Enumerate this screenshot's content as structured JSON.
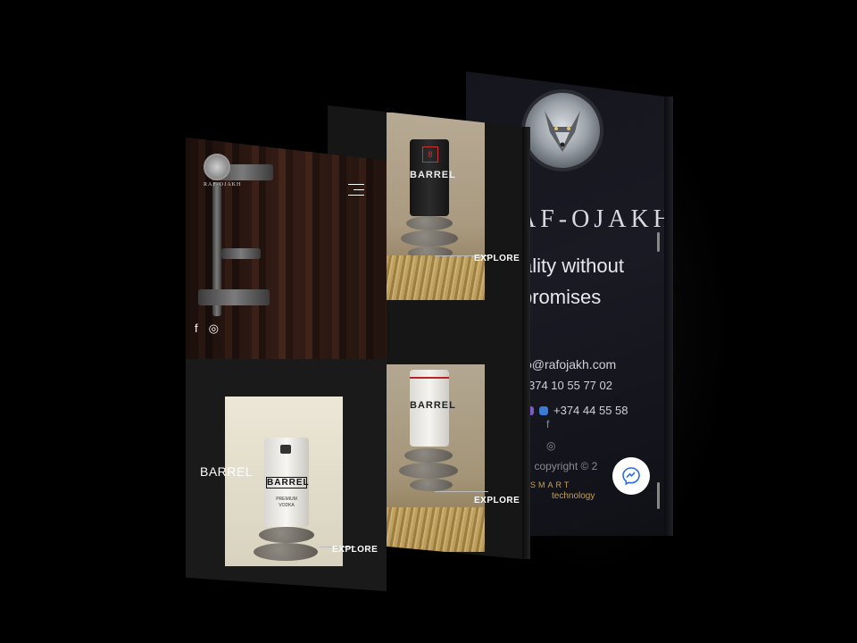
{
  "back_screen": {
    "brand": "AF-OJAKH",
    "tagline_line1": "ality without",
    "tagline_line2": "promises",
    "email": "o@rafojakh.com",
    "phone1": "374 10 55 77 02",
    "phone2": "+374 44 55 58",
    "copyright": "h | copyright © 2",
    "partner_line1": "SMART",
    "partner_line2": "technology",
    "social": [
      "f",
      "◎"
    ]
  },
  "middle_screen": {
    "products": [
      {
        "can_label": "BARREL",
        "cta": "EXPLORE"
      },
      {
        "can_label": "BARREL",
        "cta": "EXPLORE"
      }
    ]
  },
  "front_screen": {
    "logo_text": "RAF-OJAKH",
    "social": [
      "f",
      "◎"
    ],
    "product_title": "BARREL",
    "can_label": "BARREL",
    "can_sub1": "PREMIUM",
    "can_sub2": "VODKA",
    "cta": "EXPLORE"
  },
  "colors": {
    "background": "#000000",
    "accent_gold": "#c8a24a",
    "dark_screen": "#161616"
  }
}
